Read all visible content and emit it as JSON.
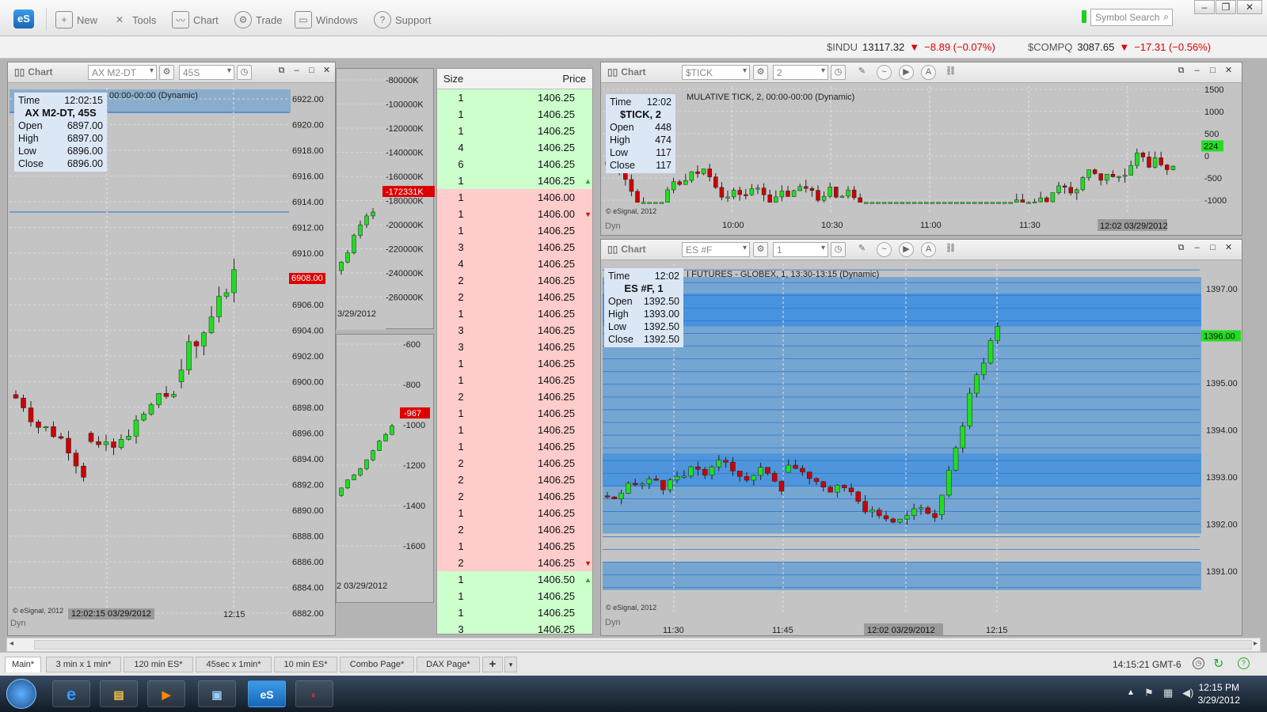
{
  "toolbar": {
    "logo": "eS",
    "new": "New",
    "tools": "Tools",
    "chart": "Chart",
    "trade": "Trade",
    "windows": "Windows",
    "support": "Support",
    "search_placeholder": "Symbol Search"
  },
  "quotes": [
    {
      "sym": "$INDU",
      "last": "13117.32",
      "chg": "−8.89 (−0.07%)"
    },
    {
      "sym": "$COMPQ",
      "last": "3087.65",
      "chg": "−17.31 (−0.56%)"
    }
  ],
  "colors": {
    "up": "#22dd22",
    "down": "#cc0000",
    "info_bg": "#dce7f6",
    "band": "#5b9bd5"
  },
  "chart_left": {
    "title": "Chart",
    "symbol": "AX M2-DT",
    "interval": "45S",
    "description": "00:00-00:00 (Dynamic)",
    "info": {
      "time_label": "Time",
      "time": "12:02:15",
      "name": "AX M2-DT, 45S",
      "open": "6897.00",
      "high": "6897.00",
      "low": "6896.00",
      "close": "6896.00"
    },
    "y_ticks": [
      "6922.00",
      "6920.00",
      "6918.00",
      "6916.00",
      "6914.00",
      "6912.00",
      "6910.00",
      "6908.00",
      "6906.00",
      "6904.00",
      "6902.00",
      "6900.00",
      "6898.00",
      "6896.00",
      "6894.00",
      "6892.00",
      "6890.00",
      "6888.00",
      "6886.00",
      "6884.00",
      "6882.00"
    ],
    "last_price": "6908.00",
    "x_labels": [
      "12:02:15 03/29/2012",
      "12:15"
    ],
    "copyright": "© eSignal, 2012",
    "dyn": "Dyn"
  },
  "chart_hidden_top": {
    "y_ticks": [
      "-80000K",
      "-100000K",
      "-120000K",
      "-140000K",
      "-160000K",
      "-180000K",
      "-200000K",
      "-220000K",
      "-240000K",
      "-260000K"
    ],
    "last": "-172331K",
    "x_label": "3/29/2012"
  },
  "chart_hidden_bottom": {
    "y_ticks": [
      "-600",
      "-800",
      "-1000",
      "-1200",
      "-1400",
      "-1600"
    ],
    "last": "-967",
    "x_label": "2 03/29/2012"
  },
  "dom": {
    "headers": {
      "size": "Size",
      "price": "Price"
    },
    "rows": [
      {
        "size": "1",
        "price": "1406.25",
        "side": "g"
      },
      {
        "size": "1",
        "price": "1406.25",
        "side": "g"
      },
      {
        "size": "1",
        "price": "1406.25",
        "side": "g"
      },
      {
        "size": "4",
        "price": "1406.25",
        "side": "g"
      },
      {
        "size": "6",
        "price": "1406.25",
        "side": "g"
      },
      {
        "size": "1",
        "price": "1406.25",
        "side": "g",
        "arrow": "up"
      },
      {
        "size": "1",
        "price": "1406.00",
        "side": "r"
      },
      {
        "size": "1",
        "price": "1406.00",
        "side": "r",
        "arrow": "down"
      },
      {
        "size": "1",
        "price": "1406.25",
        "side": "r"
      },
      {
        "size": "3",
        "price": "1406.25",
        "side": "r"
      },
      {
        "size": "4",
        "price": "1406.25",
        "side": "r"
      },
      {
        "size": "2",
        "price": "1406.25",
        "side": "r"
      },
      {
        "size": "2",
        "price": "1406.25",
        "side": "r"
      },
      {
        "size": "1",
        "price": "1406.25",
        "side": "r"
      },
      {
        "size": "3",
        "price": "1406.25",
        "side": "r"
      },
      {
        "size": "3",
        "price": "1406.25",
        "side": "r"
      },
      {
        "size": "1",
        "price": "1406.25",
        "side": "r"
      },
      {
        "size": "1",
        "price": "1406.25",
        "side": "r"
      },
      {
        "size": "2",
        "price": "1406.25",
        "side": "r"
      },
      {
        "size": "1",
        "price": "1406.25",
        "side": "r"
      },
      {
        "size": "1",
        "price": "1406.25",
        "side": "r"
      },
      {
        "size": "1",
        "price": "1406.25",
        "side": "r"
      },
      {
        "size": "2",
        "price": "1406.25",
        "side": "r"
      },
      {
        "size": "2",
        "price": "1406.25",
        "side": "r"
      },
      {
        "size": "2",
        "price": "1406.25",
        "side": "r"
      },
      {
        "size": "1",
        "price": "1406.25",
        "side": "r"
      },
      {
        "size": "2",
        "price": "1406.25",
        "side": "r"
      },
      {
        "size": "1",
        "price": "1406.25",
        "side": "r"
      },
      {
        "size": "2",
        "price": "1406.25",
        "side": "r",
        "arrow": "down"
      },
      {
        "size": "1",
        "price": "1406.50",
        "side": "g",
        "arrow": "up"
      },
      {
        "size": "1",
        "price": "1406.25",
        "side": "g"
      },
      {
        "size": "1",
        "price": "1406.25",
        "side": "g"
      },
      {
        "size": "3",
        "price": "1406.25",
        "side": "g"
      }
    ]
  },
  "chart_tick": {
    "title": "Chart",
    "symbol": "$TICK",
    "interval": "2",
    "description": "MULATIVE TICK, 2, 00:00-00:00 (Dynamic)",
    "info": {
      "time_label": "Time",
      "time": "12:02",
      "name": "$TICK, 2",
      "open": "448",
      "high": "474",
      "low": "117",
      "close": "117"
    },
    "y_ticks": [
      "1500",
      "1000",
      "500",
      "0",
      "-500",
      "-1000"
    ],
    "last": "224",
    "x_labels": [
      "10:00",
      "10:30",
      "11:00",
      "11:30",
      "12:02 03/29/2012"
    ],
    "copyright": "© eSignal, 2012",
    "dyn": "Dyn"
  },
  "chart_es": {
    "title": "Chart",
    "symbol": "ES #F",
    "interval": "1",
    "description": "I FUTURES - GLOBEX, 1, 13:30-13:15 (Dynamic)",
    "info": {
      "time_label": "Time",
      "time": "12:02",
      "name": "ES #F, 1",
      "open": "1392.50",
      "high": "1393.00",
      "low": "1392.50",
      "close": "1392.50"
    },
    "y_ticks": [
      "1397.00",
      "1396.00",
      "1395.00",
      "1394.00",
      "1393.00",
      "1392.00",
      "1391.00"
    ],
    "last": "1396.00",
    "x_labels": [
      "11:30",
      "11:45",
      "12:02 03/29/2012",
      "12:15"
    ],
    "copyright": "© eSignal, 2012",
    "dyn": "Dyn"
  },
  "tabs": [
    "Main*",
    "3 min x 1 min*",
    "120 min ES*",
    "45sec x 1min*",
    "10 min ES*",
    "Combo Page*",
    "DAX Page*",
    "+"
  ],
  "status": {
    "time": "14:15:21 GMT-6"
  },
  "taskbar": {
    "time": "12:15 PM",
    "date": "3/29/2012",
    "app_es": "eS"
  }
}
